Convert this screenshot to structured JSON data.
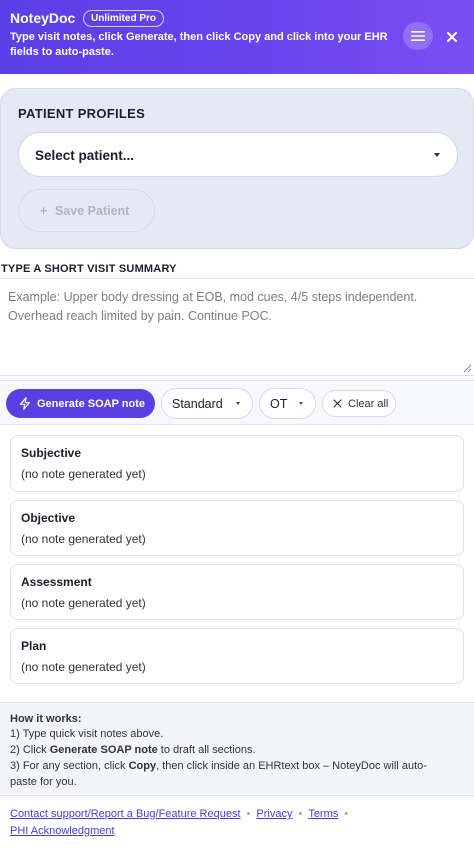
{
  "header": {
    "brand": "NoteyDoc",
    "badge": "Unlimited Pro",
    "desc_1": "Type visit notes, click ",
    "desc_generate": "Generate",
    "desc_2": ", then click ",
    "desc_copy": "Copy",
    "desc_3": " and click into your EHR fields to auto-paste.",
    "menu_icon": "hamburger-icon",
    "close_icon": "close-icon",
    "gradient_start": "#5b3fe6",
    "gradient_end": "#7b4ff4"
  },
  "profiles": {
    "title": "PATIENT PROFILES",
    "select_value": "Select patient...",
    "save_plus": "+",
    "save_label": "Save Patient"
  },
  "summary": {
    "label": "TYPE A SHORT VISIT SUMMARY",
    "placeholder": "Example: Upper body dressing at EOB, mod cues, 4/5 steps independent. Overhead reach limited by pain. Continue POC."
  },
  "toolbar": {
    "generate_label": "Generate SOAP note",
    "style_value": "Standard",
    "discipline_value": "OT",
    "clear_label": "Clear all",
    "accent": "#5a3fe2"
  },
  "sections": [
    {
      "title": "Subjective",
      "body": "(no note generated yet)"
    },
    {
      "title": "Objective",
      "body": "(no note generated yet)"
    },
    {
      "title": "Assessment",
      "body": "(no note generated yet)"
    },
    {
      "title": "Plan",
      "body": "(no note generated yet)"
    }
  ],
  "how": {
    "title": "How it works:",
    "step1": "1) Type quick visit notes above.",
    "step2_a": "2) Click ",
    "step2_b": "Generate SOAP note",
    "step2_c": " to draft all sections.",
    "step3_a": "3) For any section, click ",
    "step3_b": "Copy",
    "step3_c": ", then click inside an EHRtext box – NoteyDoc will auto-",
    "step3_d": "paste for you."
  },
  "footer": {
    "support": "Contact support/Report a Bug/Feature Request",
    "privacy": "Privacy",
    "terms": "Terms",
    "phi": "PHI Acknowledgment",
    "sep": "•"
  }
}
